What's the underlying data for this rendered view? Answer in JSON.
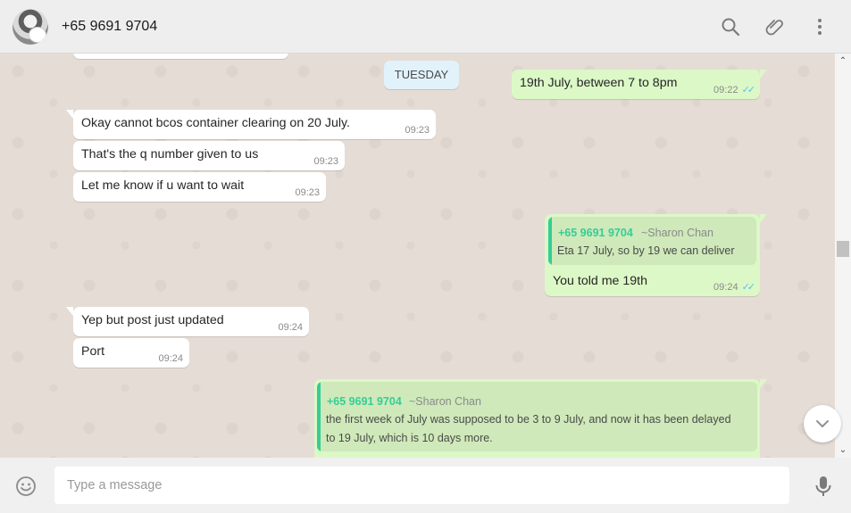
{
  "header": {
    "contact_name": "+65 9691 9704",
    "avatar_icon": "avatar-photo",
    "icons": [
      "search-icon",
      "attach-icon",
      "menu-icon"
    ]
  },
  "chat": {
    "day_separator": "TUESDAY",
    "messages": [
      {
        "direction": "out",
        "text": "19th July, between 7 to 8pm",
        "time": "09:22",
        "status": "read"
      },
      {
        "direction": "in",
        "text": "Okay cannot bcos container clearing on 20 July.",
        "time": "09:23"
      },
      {
        "direction": "in",
        "text": "That's the q number given to us",
        "time": "09:23"
      },
      {
        "direction": "in",
        "text": "Let me know if u want to wait",
        "time": "09:23"
      },
      {
        "direction": "out",
        "text": "You told me 19th",
        "time": "09:24",
        "status": "read",
        "quote": {
          "name": "+65 9691 9704",
          "alias": "~Sharon Chan",
          "text": "Eta 17 July, so by 19 we can deliver"
        }
      },
      {
        "direction": "in",
        "text": "Yep but post just updated",
        "time": "09:24"
      },
      {
        "direction": "in",
        "text": "Port",
        "time": "09:24"
      },
      {
        "direction": "out",
        "text": "",
        "time": "",
        "quote": {
          "name": "+65 9691 9704",
          "alias": "~Sharon Chan",
          "text_line1": "the first week of July was supposed to be 3 to 9 July, and now it has been delayed",
          "text_line2": "to 19 July, which is 10 days more."
        }
      }
    ]
  },
  "composer": {
    "placeholder": "Type a message",
    "emoji_icon": "emoji-icon",
    "mic_icon": "mic-icon"
  },
  "colors": {
    "incoming_bubble": "#ffffff",
    "outgoing_bubble": "#dcf8c6",
    "quote_accent": "#35cd96",
    "read_ticks": "#4fc3f7",
    "chat_background": "#e5ddd5"
  }
}
